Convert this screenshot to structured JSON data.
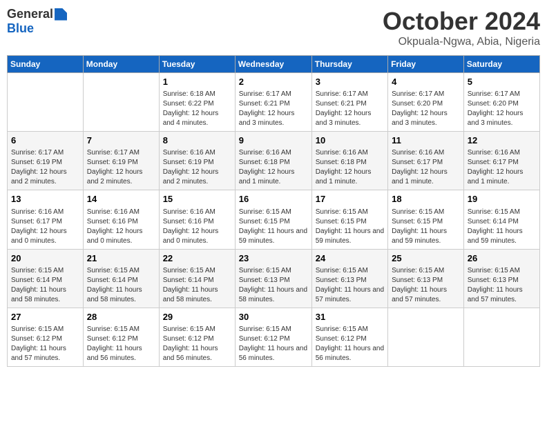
{
  "logo": {
    "general": "General",
    "blue": "Blue"
  },
  "title": "October 2024",
  "location": "Okpuala-Ngwa, Abia, Nigeria",
  "days_of_week": [
    "Sunday",
    "Monday",
    "Tuesday",
    "Wednesday",
    "Thursday",
    "Friday",
    "Saturday"
  ],
  "weeks": [
    [
      {
        "day": "",
        "info": ""
      },
      {
        "day": "",
        "info": ""
      },
      {
        "day": "1",
        "info": "Sunrise: 6:18 AM\nSunset: 6:22 PM\nDaylight: 12 hours and 4 minutes."
      },
      {
        "day": "2",
        "info": "Sunrise: 6:17 AM\nSunset: 6:21 PM\nDaylight: 12 hours and 3 minutes."
      },
      {
        "day": "3",
        "info": "Sunrise: 6:17 AM\nSunset: 6:21 PM\nDaylight: 12 hours and 3 minutes."
      },
      {
        "day": "4",
        "info": "Sunrise: 6:17 AM\nSunset: 6:20 PM\nDaylight: 12 hours and 3 minutes."
      },
      {
        "day": "5",
        "info": "Sunrise: 6:17 AM\nSunset: 6:20 PM\nDaylight: 12 hours and 3 minutes."
      }
    ],
    [
      {
        "day": "6",
        "info": "Sunrise: 6:17 AM\nSunset: 6:19 PM\nDaylight: 12 hours and 2 minutes."
      },
      {
        "day": "7",
        "info": "Sunrise: 6:17 AM\nSunset: 6:19 PM\nDaylight: 12 hours and 2 minutes."
      },
      {
        "day": "8",
        "info": "Sunrise: 6:16 AM\nSunset: 6:19 PM\nDaylight: 12 hours and 2 minutes."
      },
      {
        "day": "9",
        "info": "Sunrise: 6:16 AM\nSunset: 6:18 PM\nDaylight: 12 hours and 1 minute."
      },
      {
        "day": "10",
        "info": "Sunrise: 6:16 AM\nSunset: 6:18 PM\nDaylight: 12 hours and 1 minute."
      },
      {
        "day": "11",
        "info": "Sunrise: 6:16 AM\nSunset: 6:17 PM\nDaylight: 12 hours and 1 minute."
      },
      {
        "day": "12",
        "info": "Sunrise: 6:16 AM\nSunset: 6:17 PM\nDaylight: 12 hours and 1 minute."
      }
    ],
    [
      {
        "day": "13",
        "info": "Sunrise: 6:16 AM\nSunset: 6:17 PM\nDaylight: 12 hours and 0 minutes."
      },
      {
        "day": "14",
        "info": "Sunrise: 6:16 AM\nSunset: 6:16 PM\nDaylight: 12 hours and 0 minutes."
      },
      {
        "day": "15",
        "info": "Sunrise: 6:16 AM\nSunset: 6:16 PM\nDaylight: 12 hours and 0 minutes."
      },
      {
        "day": "16",
        "info": "Sunrise: 6:15 AM\nSunset: 6:15 PM\nDaylight: 11 hours and 59 minutes."
      },
      {
        "day": "17",
        "info": "Sunrise: 6:15 AM\nSunset: 6:15 PM\nDaylight: 11 hours and 59 minutes."
      },
      {
        "day": "18",
        "info": "Sunrise: 6:15 AM\nSunset: 6:15 PM\nDaylight: 11 hours and 59 minutes."
      },
      {
        "day": "19",
        "info": "Sunrise: 6:15 AM\nSunset: 6:14 PM\nDaylight: 11 hours and 59 minutes."
      }
    ],
    [
      {
        "day": "20",
        "info": "Sunrise: 6:15 AM\nSunset: 6:14 PM\nDaylight: 11 hours and 58 minutes."
      },
      {
        "day": "21",
        "info": "Sunrise: 6:15 AM\nSunset: 6:14 PM\nDaylight: 11 hours and 58 minutes."
      },
      {
        "day": "22",
        "info": "Sunrise: 6:15 AM\nSunset: 6:14 PM\nDaylight: 11 hours and 58 minutes."
      },
      {
        "day": "23",
        "info": "Sunrise: 6:15 AM\nSunset: 6:13 PM\nDaylight: 11 hours and 58 minutes."
      },
      {
        "day": "24",
        "info": "Sunrise: 6:15 AM\nSunset: 6:13 PM\nDaylight: 11 hours and 57 minutes."
      },
      {
        "day": "25",
        "info": "Sunrise: 6:15 AM\nSunset: 6:13 PM\nDaylight: 11 hours and 57 minutes."
      },
      {
        "day": "26",
        "info": "Sunrise: 6:15 AM\nSunset: 6:13 PM\nDaylight: 11 hours and 57 minutes."
      }
    ],
    [
      {
        "day": "27",
        "info": "Sunrise: 6:15 AM\nSunset: 6:12 PM\nDaylight: 11 hours and 57 minutes."
      },
      {
        "day": "28",
        "info": "Sunrise: 6:15 AM\nSunset: 6:12 PM\nDaylight: 11 hours and 56 minutes."
      },
      {
        "day": "29",
        "info": "Sunrise: 6:15 AM\nSunset: 6:12 PM\nDaylight: 11 hours and 56 minutes."
      },
      {
        "day": "30",
        "info": "Sunrise: 6:15 AM\nSunset: 6:12 PM\nDaylight: 11 hours and 56 minutes."
      },
      {
        "day": "31",
        "info": "Sunrise: 6:15 AM\nSunset: 6:12 PM\nDaylight: 11 hours and 56 minutes."
      },
      {
        "day": "",
        "info": ""
      },
      {
        "day": "",
        "info": ""
      }
    ]
  ]
}
